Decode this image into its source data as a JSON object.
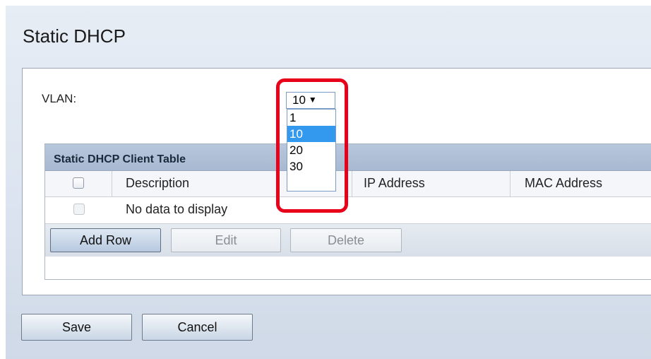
{
  "page": {
    "title": "Static DHCP"
  },
  "vlan": {
    "label": "VLAN:",
    "selected": "10",
    "options": [
      "1",
      "10",
      "20",
      "30"
    ],
    "arrow": "▼"
  },
  "table": {
    "caption": "Static DHCP Client Table",
    "columns": [
      "Description",
      "IP Address",
      "MAC Address"
    ],
    "empty_message": "No data to display",
    "buttons": {
      "add": "Add Row",
      "edit": "Edit",
      "delete": "Delete"
    }
  },
  "footer": {
    "save": "Save",
    "cancel": "Cancel"
  },
  "colors": {
    "highlight": "#e8001b",
    "selected_option": "#3399ee"
  }
}
